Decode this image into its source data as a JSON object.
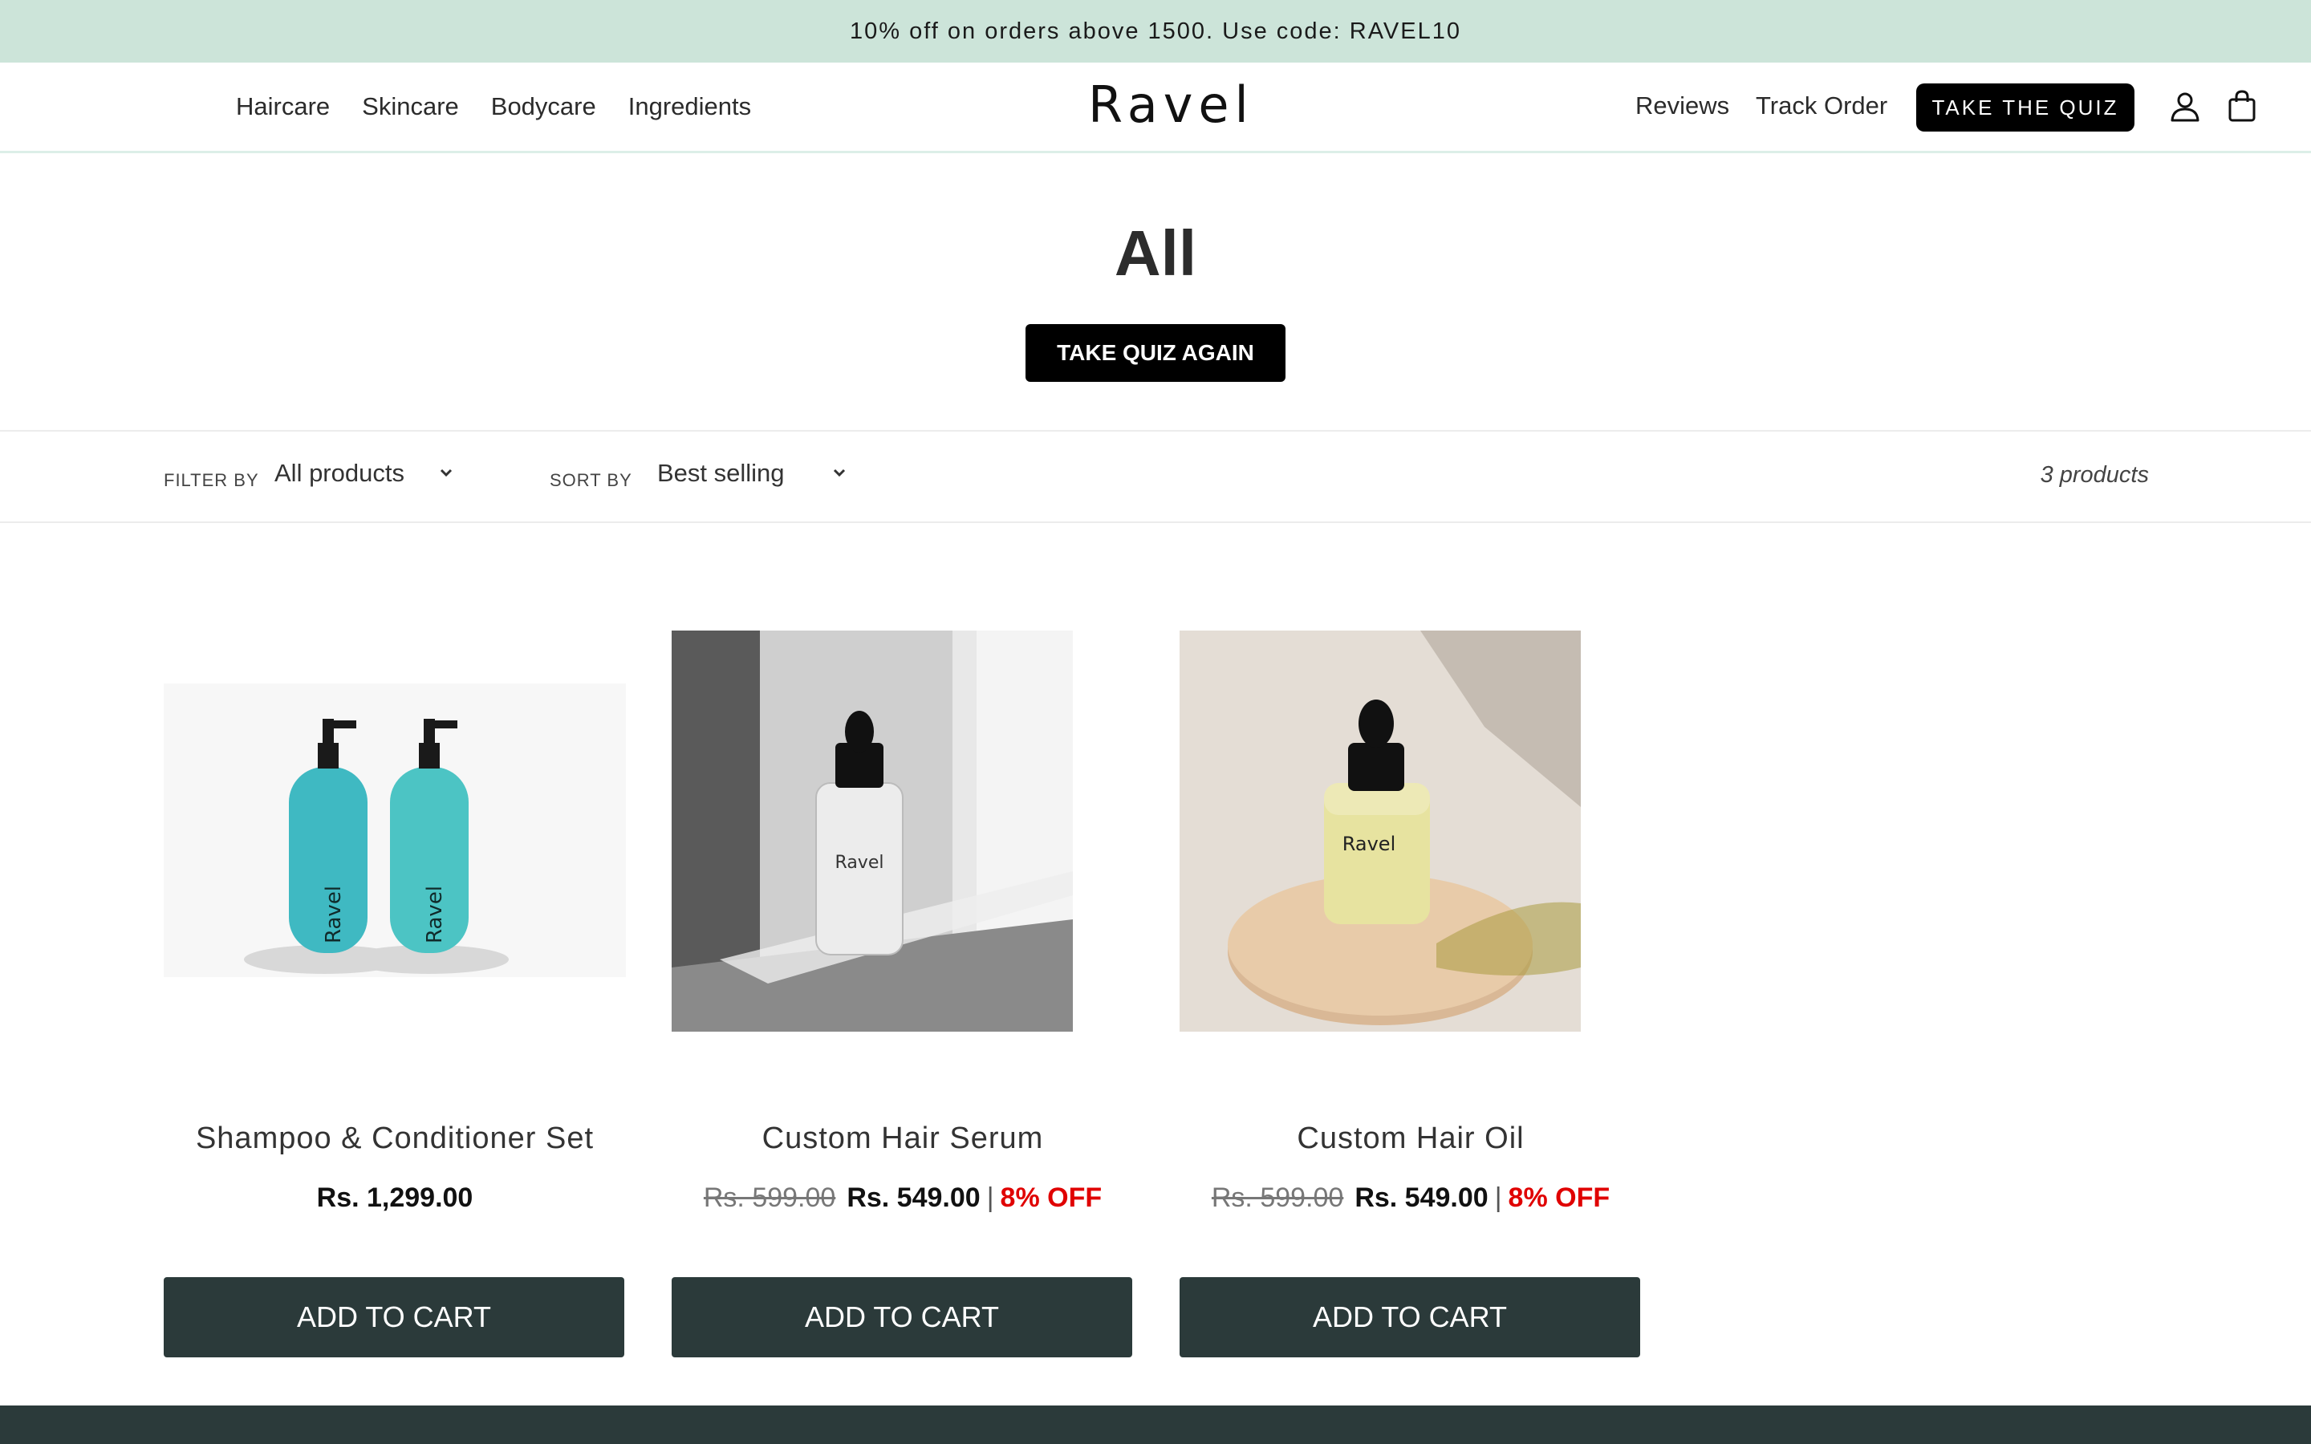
{
  "announcement": "10% off on orders above 1500. Use code: RAVEL10",
  "header": {
    "logo": "Ravel",
    "nav_left": [
      "Haircare",
      "Skincare",
      "Bodycare",
      "Ingredients"
    ],
    "nav_right": {
      "reviews": "Reviews",
      "track": "Track Order",
      "quiz": "TAKE THE QUIZ"
    },
    "icons": [
      "user-icon",
      "bag-icon"
    ]
  },
  "collection": {
    "title": "All",
    "retake": "TAKE QUIZ AGAIN"
  },
  "filters": {
    "filter_label": "FILTER BY",
    "filter_value": "All products",
    "sort_label": "SORT BY",
    "sort_value": "Best selling",
    "count": "3 products"
  },
  "products": [
    {
      "name": "Shampoo & Conditioner Set",
      "compare": "",
      "price": "Rs. 1,299.00",
      "discount": "",
      "button": "ADD TO CART",
      "image_label": "Ravel"
    },
    {
      "name": "Custom Hair Serum",
      "compare": "Rs. 599.00",
      "price": "Rs. 549.00",
      "discount": "8% OFF",
      "button": "ADD TO CART",
      "image_label": "Ravel"
    },
    {
      "name": "Custom Hair Oil",
      "compare": "Rs. 599.00",
      "price": "Rs. 549.00",
      "discount": "8% OFF",
      "button": "ADD TO CART",
      "image_label": "Ravel"
    }
  ],
  "colors": {
    "announcement_bg": "#cce4d9",
    "button_dark": "#2b3a3a",
    "discount": "#e00000"
  }
}
